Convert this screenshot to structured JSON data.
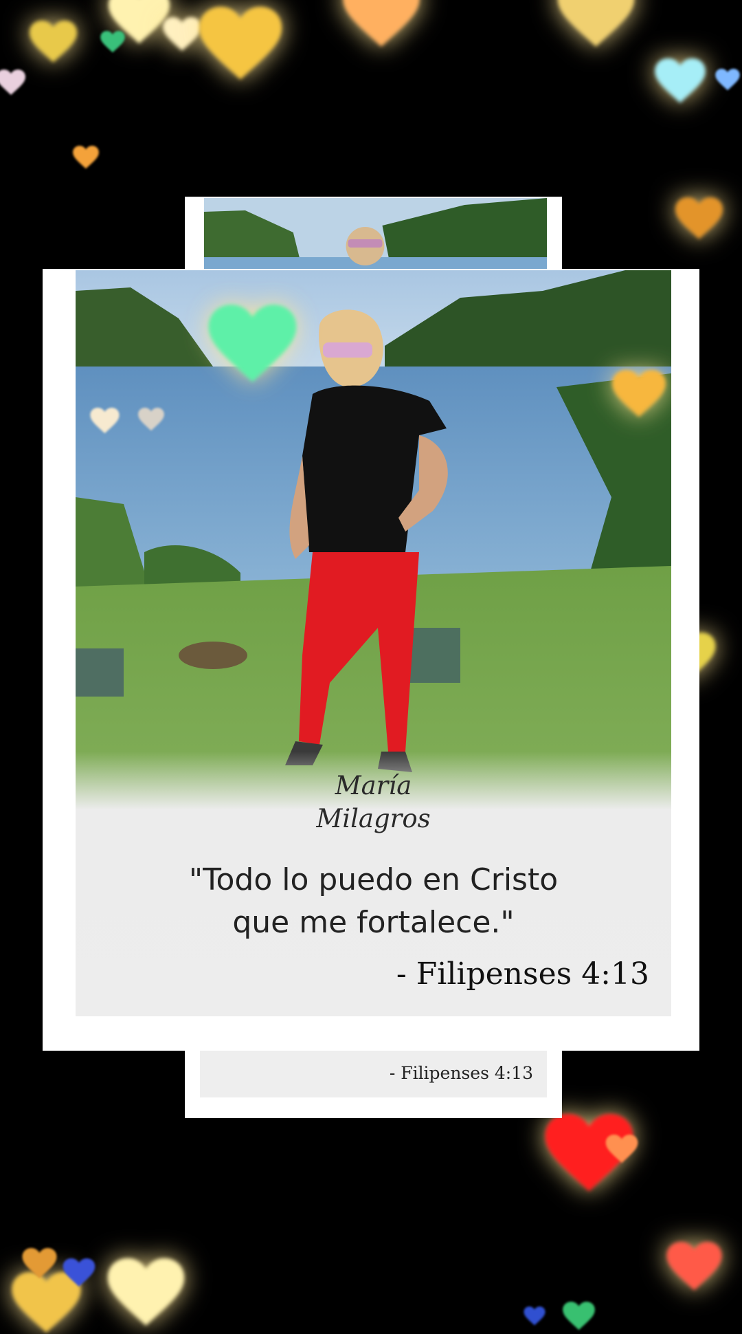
{
  "photo": {
    "signature_line1": "María",
    "signature_line2": "Milagros",
    "quote_line1": "\"Todo lo puedo en Cristo",
    "quote_line2": "que me fortalece.\"",
    "citation": "- Filipenses 4:13"
  },
  "back_photo": {
    "citation": "- Filipenses 4:13"
  },
  "colors": {
    "background": "#000000",
    "card": "#ffffff",
    "heart_yellow": "#ffd24d",
    "heart_red": "#ff2a2a",
    "heart_cyan": "#9ff2ff",
    "heart_green": "#5ef0a8"
  }
}
